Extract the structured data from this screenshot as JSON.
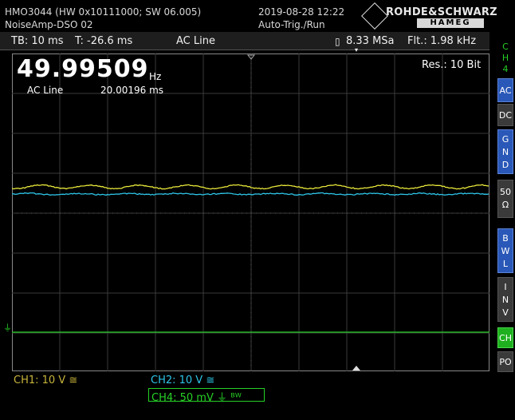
{
  "header": {
    "device": "HMO3044 (HW 0x10111000; SW 06.005)",
    "datetime": "2019-08-28 12:22",
    "project": "NoiseAmp-DSO 02",
    "trigger_mode": "Auto-Trig./Run",
    "logo_top": "ROHDE&SCHWARZ",
    "logo_bottom": "HAMEG"
  },
  "status": {
    "timebase": "TB: 10 ms",
    "trigger_time": "T: -26.6 ms",
    "trigger_source": "AC Line",
    "sample_rate": "8.33 MSa",
    "filter": "Flt.: 1.98 kHz"
  },
  "screen": {
    "frequency": "49.99509",
    "frequency_unit": "Hz",
    "counter_source": "AC Line",
    "period": "20.00196 ms",
    "resolution": "Res.: 10 Bit"
  },
  "side_menu": {
    "channel": [
      "C",
      "H",
      "4"
    ],
    "ac": "AC",
    "dc": "DC",
    "gnd": [
      "G",
      "N",
      "D"
    ],
    "ohm": [
      "50",
      "Ω"
    ],
    "bwl": [
      "B",
      "W",
      "L"
    ],
    "inv": [
      "I",
      "N",
      "V"
    ],
    "ch": "CH",
    "po": "PO"
  },
  "channels": {
    "ch1": "CH1: 10 V ≅",
    "ch2": "CH2: 10 V ≅",
    "ch4": "CH4: 50 mV ⏚ ᴮᵂ"
  },
  "colors": {
    "ch1": "#e8e83a",
    "ch2": "#2ec4e8",
    "ch4": "#26d026",
    "accent_blue": "#2a58b8"
  }
}
